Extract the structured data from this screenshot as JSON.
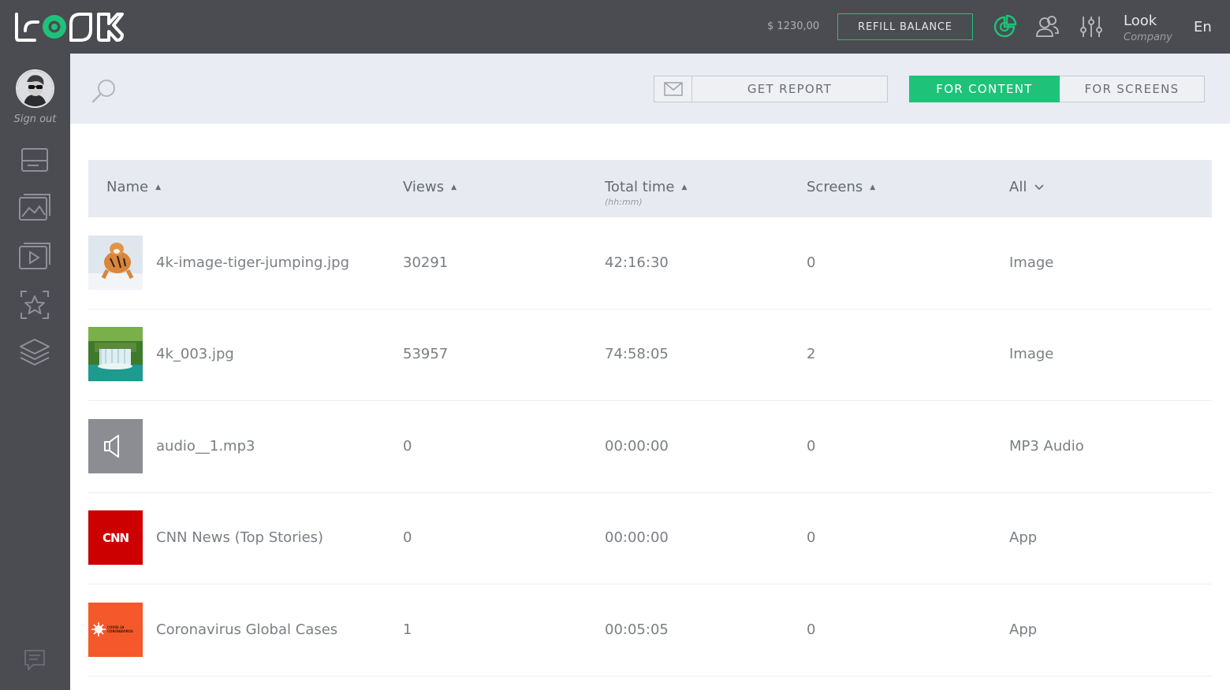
{
  "header": {
    "logo_text": "LOOK",
    "balance": "$ 1230,00",
    "refill_label": "REFILL BALANCE",
    "user_name": "Look",
    "user_company": "Company",
    "language": "En",
    "icons": [
      "analytics-icon",
      "users-icon",
      "settings-sliders-icon"
    ]
  },
  "sidebar": {
    "signout_label": "Sign out",
    "items": [
      "screens-icon",
      "images-icon",
      "videos-icon",
      "templates-icon",
      "layers-icon",
      "chat-icon"
    ]
  },
  "toolbar": {
    "get_report_label": "GET REPORT",
    "tab_content_label": "FOR CONTENT",
    "tab_screens_label": "FOR SCREENS",
    "active_tab": "FOR CONTENT"
  },
  "table": {
    "columns": {
      "name": "Name",
      "views": "Views",
      "total_time": "Total time",
      "total_time_unit": "(hh:mm)",
      "screens": "Screens",
      "type_filter": "All"
    },
    "rows": [
      {
        "name": "4k-image-tiger-jumping.jpg",
        "views": "30291",
        "time": "42:16:30",
        "screens": "0",
        "type": "Image",
        "thumb": "tiger"
      },
      {
        "name": "4k_003.jpg",
        "views": "53957",
        "time": "74:58:05",
        "screens": "2",
        "type": "Image",
        "thumb": "waterfall"
      },
      {
        "name": "audio__1.mp3",
        "views": "0",
        "time": "00:00:00",
        "screens": "0",
        "type": "MP3 Audio",
        "thumb": "audio"
      },
      {
        "name": "CNN News (Top Stories)",
        "views": "0",
        "time": "00:00:00",
        "screens": "0",
        "type": "App",
        "thumb": "cnn",
        "thumb_text": "CNN"
      },
      {
        "name": "Coronavirus Global Cases",
        "views": "1",
        "time": "00:05:05",
        "screens": "0",
        "type": "App",
        "thumb": "covid",
        "thumb_text": "COVID-19 CORONAVIRUS"
      }
    ]
  },
  "colors": {
    "accent": "#1ec279",
    "topbar": "#4b4c51",
    "toolbar": "#e9ecf2"
  }
}
